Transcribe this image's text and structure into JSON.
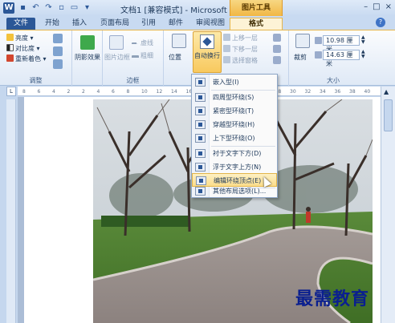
{
  "titlebar": {
    "doc_title": "文档1 [兼容模式] - Microsoft Word",
    "context_tool": "图片工具",
    "app_icon": "W",
    "window_buttons": [
      "–",
      "□",
      "×"
    ]
  },
  "tabs": [
    "文件",
    "开始",
    "插入",
    "页面布局",
    "引用",
    "邮件",
    "审阅",
    "视图",
    "格式"
  ],
  "ribbon": {
    "adjust": {
      "brightness": "亮度 ▾",
      "contrast": "对比度 ▾",
      "recolor": "重新着色 ▾",
      "group": "调整"
    },
    "shadow": {
      "label": "阴影效果",
      "group": ""
    },
    "border": {
      "picture_border": "图片边框",
      "dash": "虚线",
      "weight": "粗细",
      "group": "边框"
    },
    "arrange": {
      "position": "位置",
      "wrap": "自动换行",
      "bring_forward": "上移一层",
      "send_backward": "下移一层",
      "selection_pane": "选择窗格"
    },
    "size": {
      "crop": "裁剪",
      "height": "10.98 厘米",
      "width": "14.63 厘米",
      "group": "大小"
    }
  },
  "ruler": {
    "corner": "L",
    "marks": [
      "8",
      "6",
      "4",
      "2",
      "2",
      "4",
      "6",
      "8",
      "10",
      "12",
      "14",
      "16",
      "18",
      "20",
      "22",
      "24",
      "26",
      "28",
      "30",
      "32",
      "34",
      "36",
      "38",
      "40"
    ]
  },
  "menu": {
    "items": [
      "嵌入型(I)",
      "四周型环绕(S)",
      "紧密型环绕(T)",
      "穿越型环绕(H)",
      "上下型环绕(O)",
      "衬于文字下方(D)",
      "浮于文字上方(N)",
      "编辑环绕顶点(E)",
      "其他布局选项(L)..."
    ],
    "highlighted_index": 7
  },
  "watermark": "最需教育",
  "colors": {
    "accent": "#2b5797",
    "context_tab": "#f1b745",
    "menu_highlight": "#fbdd8b",
    "watermark": "#0a1f8f"
  }
}
